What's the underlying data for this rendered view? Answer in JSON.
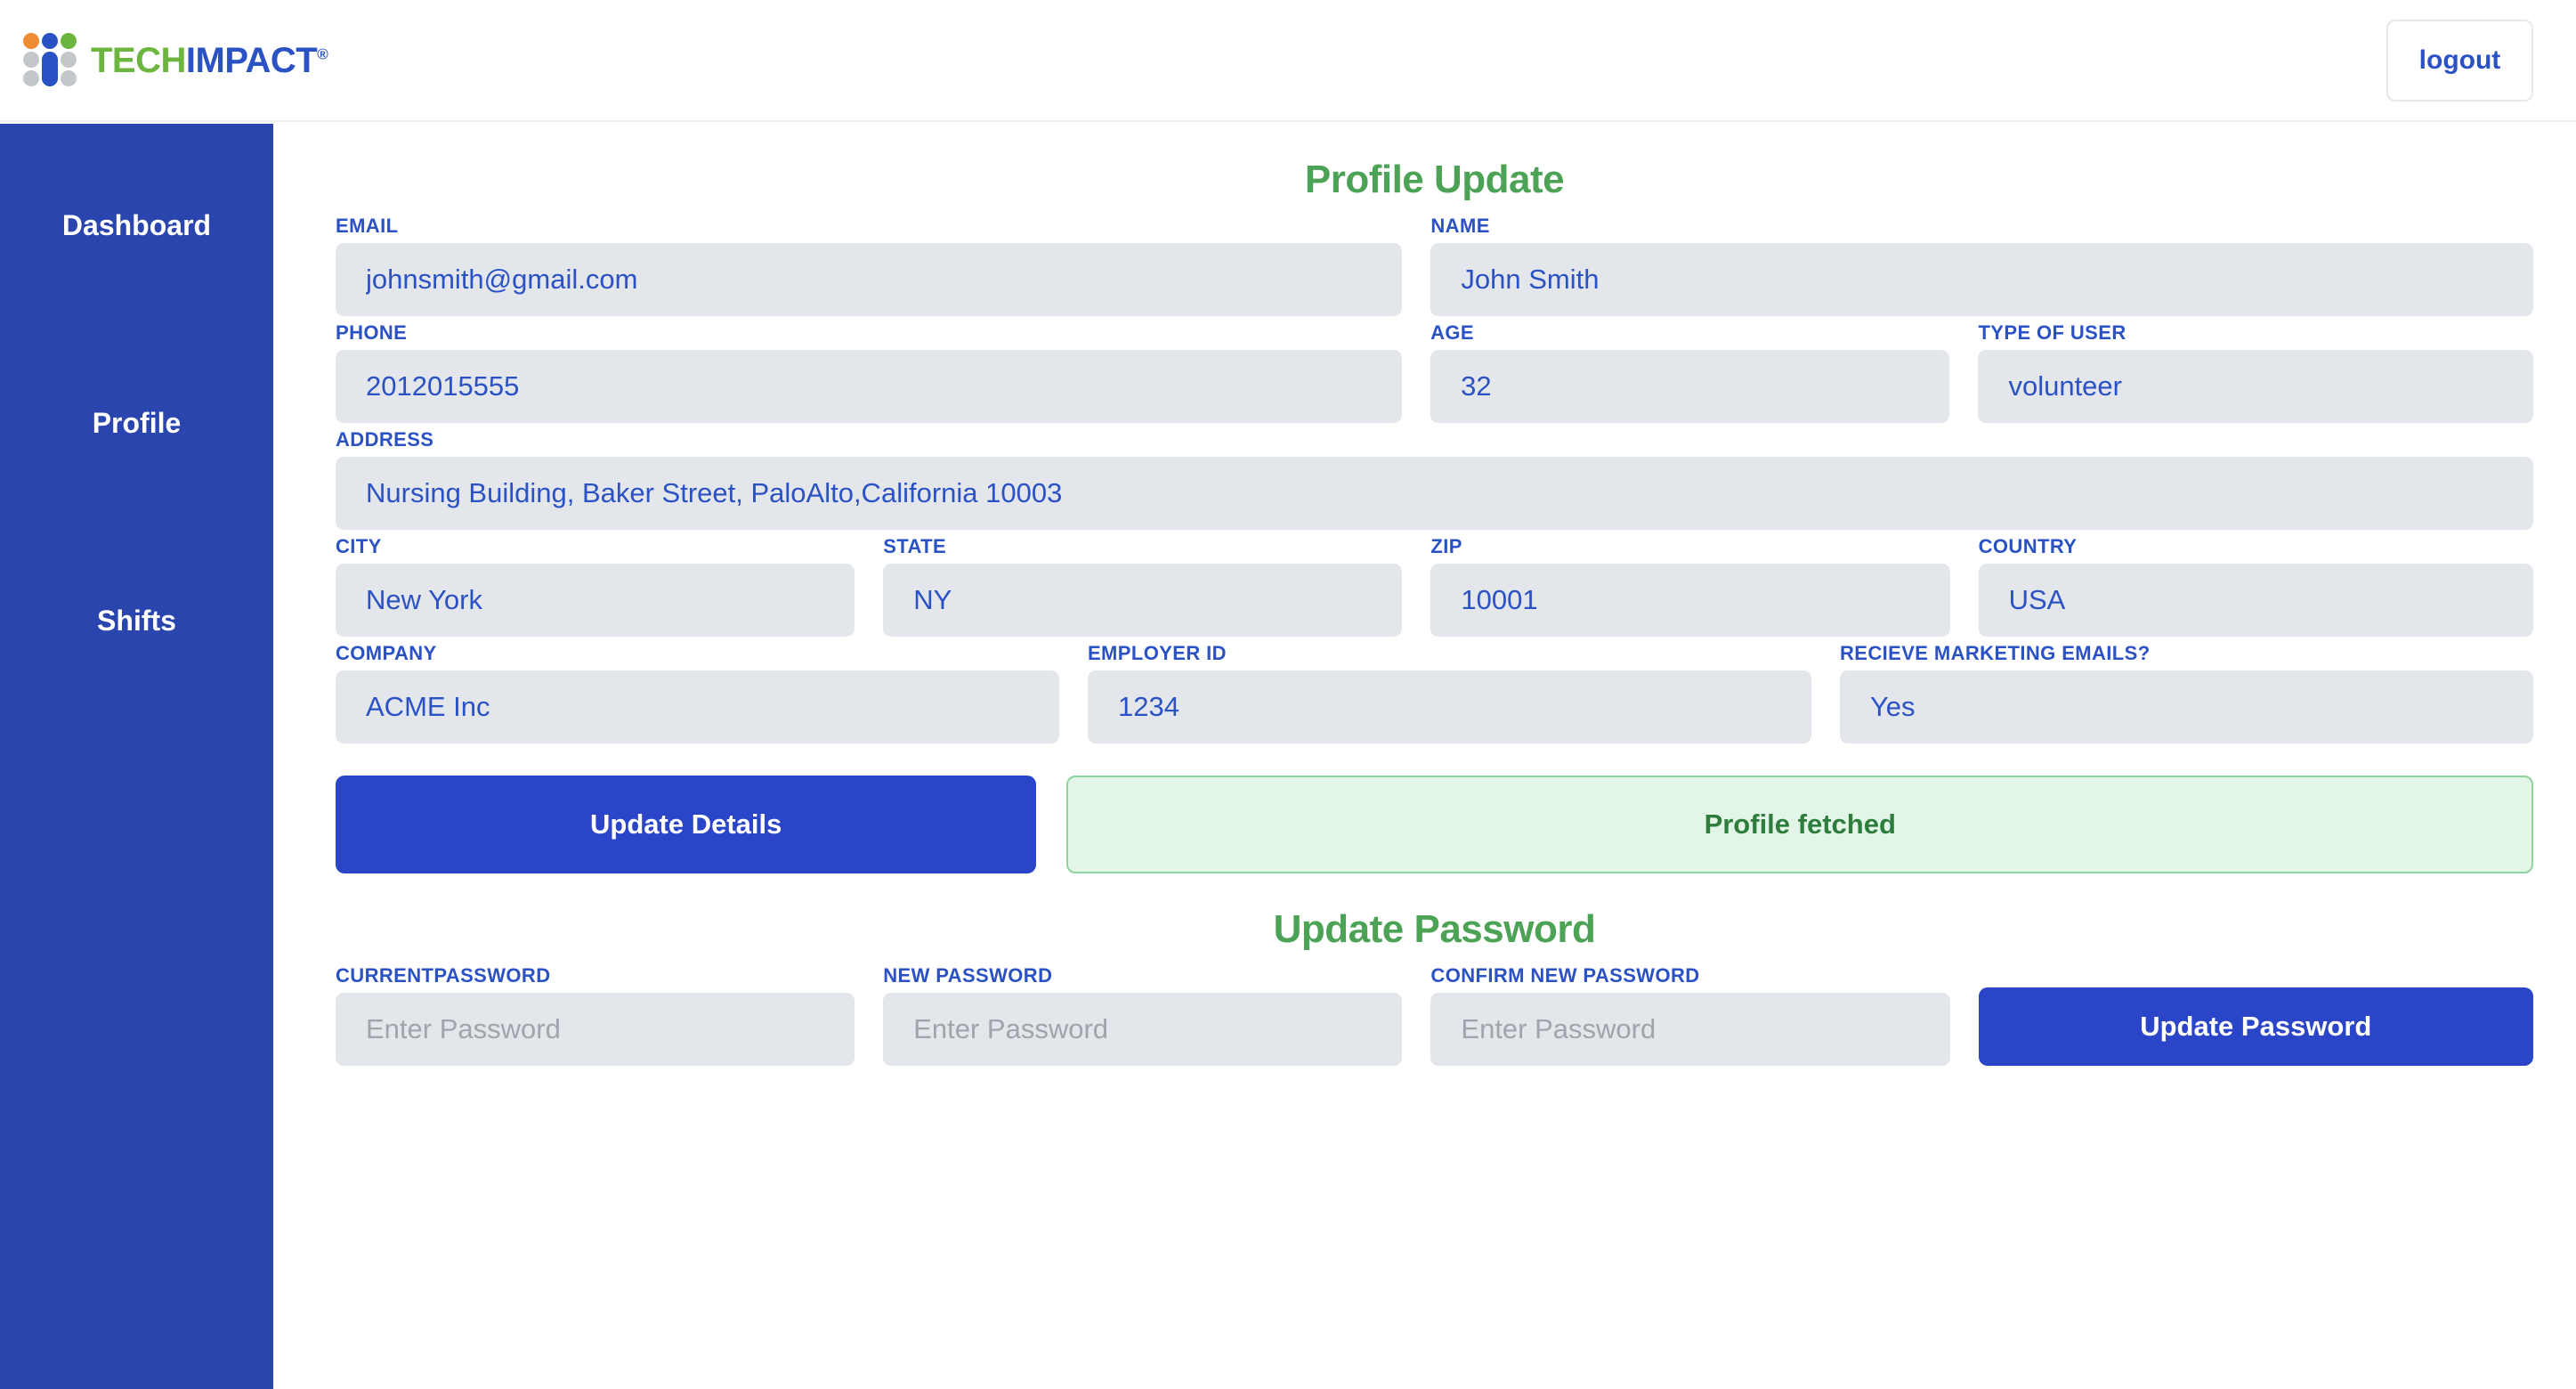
{
  "header": {
    "logo": {
      "text_tech": "TECH",
      "text_impact": "IMPACT",
      "registered": "®"
    },
    "logout_label": "logout"
  },
  "sidebar": {
    "items": [
      {
        "label": "Dashboard"
      },
      {
        "label": "Profile"
      },
      {
        "label": "Shifts"
      }
    ]
  },
  "profile_section": {
    "title": "Profile Update",
    "fields": {
      "email": {
        "label": "EMAIL",
        "value": "johnsmith@gmail.com"
      },
      "name": {
        "label": "NAME",
        "value": "John Smith"
      },
      "phone": {
        "label": "PHONE",
        "value": "2012015555"
      },
      "age": {
        "label": "AGE",
        "value": "32"
      },
      "type": {
        "label": "TYPE OF USER",
        "value": "volunteer"
      },
      "address": {
        "label": "ADDRESS",
        "value": "Nursing Building, Baker Street, PaloAlto,California 10003"
      },
      "city": {
        "label": "CITY",
        "value": "New York"
      },
      "state": {
        "label": "STATE",
        "value": "NY"
      },
      "zip": {
        "label": "ZIP",
        "value": "10001"
      },
      "country": {
        "label": "COUNTRY",
        "value": "USA"
      },
      "company": {
        "label": "COMPANY",
        "value": "ACME Inc"
      },
      "employer": {
        "label": "EMPLOYER ID",
        "value": "1234"
      },
      "marketing": {
        "label": "RECIEVE MARKETING EMAILS?",
        "value": "Yes"
      }
    },
    "update_button": "Update Details",
    "status_message": "Profile fetched"
  },
  "password_section": {
    "title": "Update Password",
    "fields": {
      "current": {
        "label": "CURRENTPASSWORD",
        "placeholder": "Enter Password",
        "value": ""
      },
      "new": {
        "label": "NEW PASSWORD",
        "placeholder": "Enter Password",
        "value": ""
      },
      "confirm": {
        "label": "CONFIRM NEW PASSWORD",
        "placeholder": "Enter Password",
        "value": ""
      }
    },
    "update_button": "Update Password"
  },
  "colors": {
    "brand_blue": "#2b52c4",
    "brand_green": "#6cb63f",
    "brand_orange": "#ef8b33",
    "sidebar_blue": "#2a45ae",
    "heading_green": "#4ca356",
    "input_bg": "#e3e6ea",
    "button_blue": "#2b45c9",
    "success_bg": "#e2f5e6",
    "success_text": "#2f7d3d"
  }
}
